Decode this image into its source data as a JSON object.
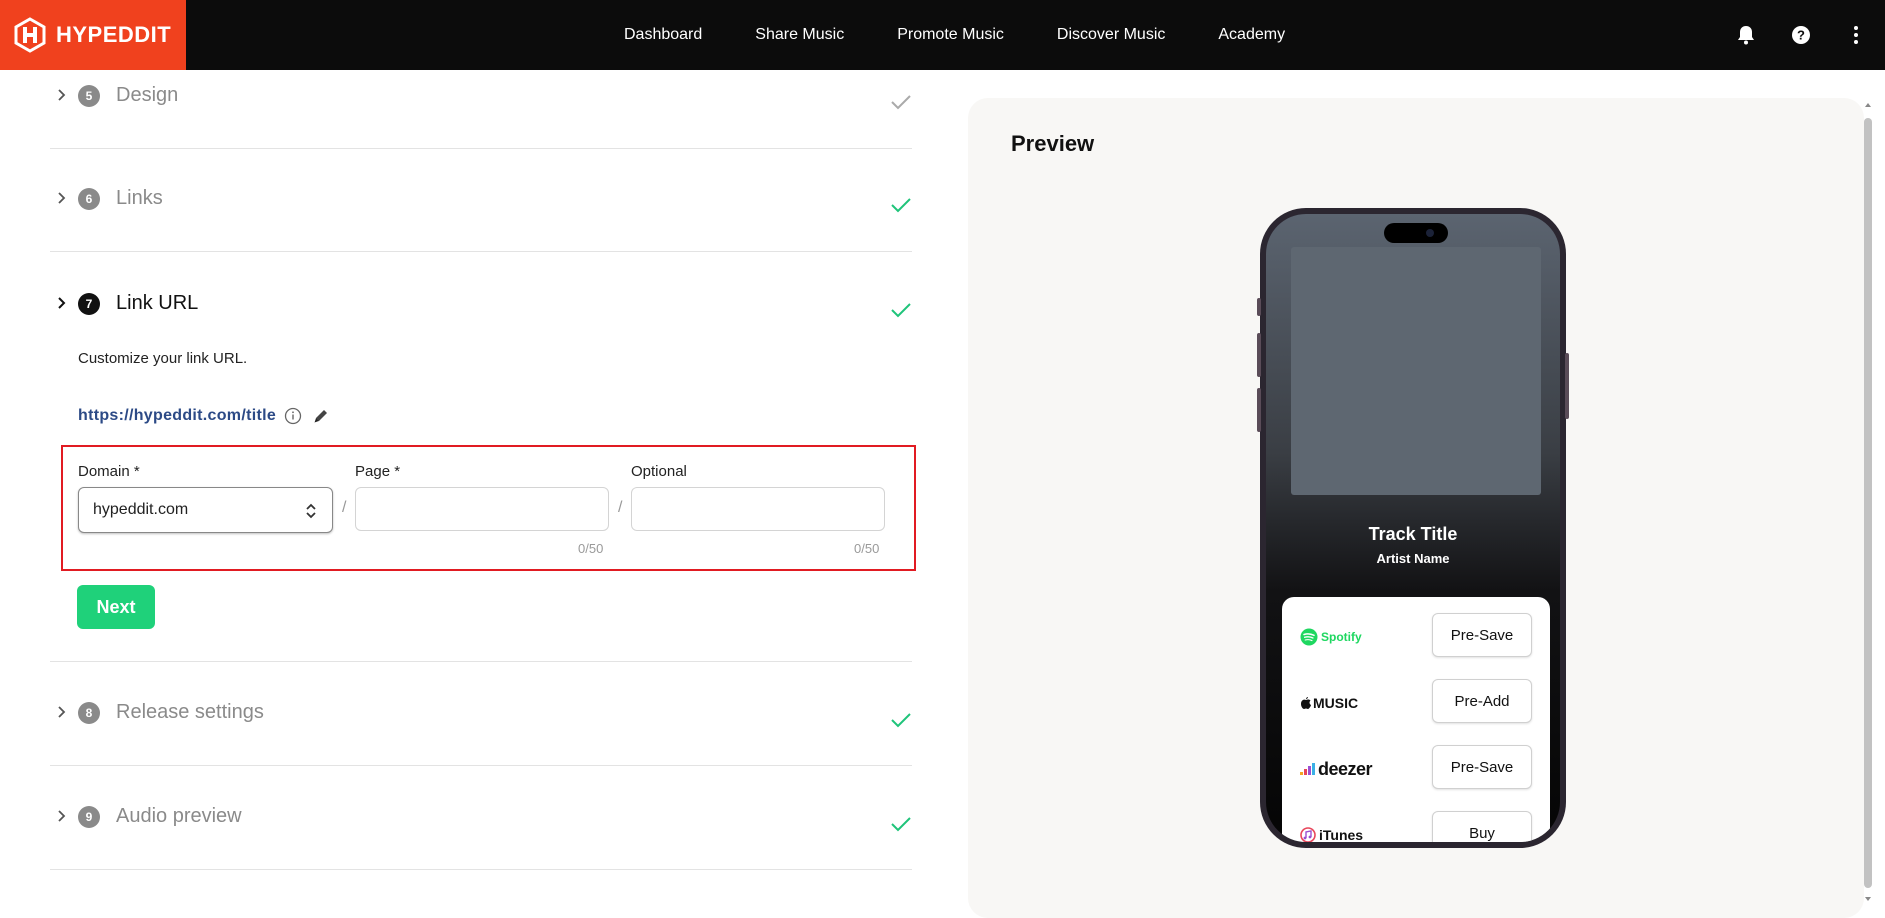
{
  "brand": {
    "name": "HYPEDDIT",
    "logo_color": "#f0411e"
  },
  "nav": {
    "items": [
      "Dashboard",
      "Share Music",
      "Promote Music",
      "Discover Music",
      "Academy"
    ]
  },
  "top_icons": [
    "bell-icon",
    "help-icon",
    "more-vertical-icon"
  ],
  "sections": [
    {
      "number": "5",
      "title": "Design",
      "status": "complete-grey"
    },
    {
      "number": "6",
      "title": "Links",
      "status": "complete"
    },
    {
      "number": "7",
      "title": "Link URL",
      "status": "complete",
      "active": true
    },
    {
      "number": "8",
      "title": "Release settings",
      "status": "complete"
    },
    {
      "number": "9",
      "title": "Audio preview",
      "status": "complete"
    }
  ],
  "link_url": {
    "description": "Customize your link URL.",
    "url": "https://hypeddit.com/title",
    "domain_label": "Domain *",
    "domain_value": "hypeddit.com",
    "page_label": "Page *",
    "page_value": "",
    "page_counter": "0/50",
    "optional_label": "Optional",
    "optional_value": "",
    "optional_counter": "0/50",
    "separator": "/",
    "next_label": "Next"
  },
  "preview": {
    "title": "Preview",
    "track_title": "Track Title",
    "artist_name": "Artist Name",
    "services": [
      {
        "name": "Spotify",
        "action": "Pre-Save",
        "color": "#1ed760"
      },
      {
        "name": "MUSIC",
        "action": "Pre-Add",
        "color": "#111111"
      },
      {
        "name": "deezer",
        "action": "Pre-Save",
        "color": "#111111"
      },
      {
        "name": "iTunes",
        "action": "Buy",
        "color": "#111111"
      }
    ]
  },
  "colors": {
    "accent_green": "#1fd17a",
    "check_green": "#1fc47a",
    "highlight_red": "#e11b22",
    "url_blue": "#2c4a86"
  }
}
